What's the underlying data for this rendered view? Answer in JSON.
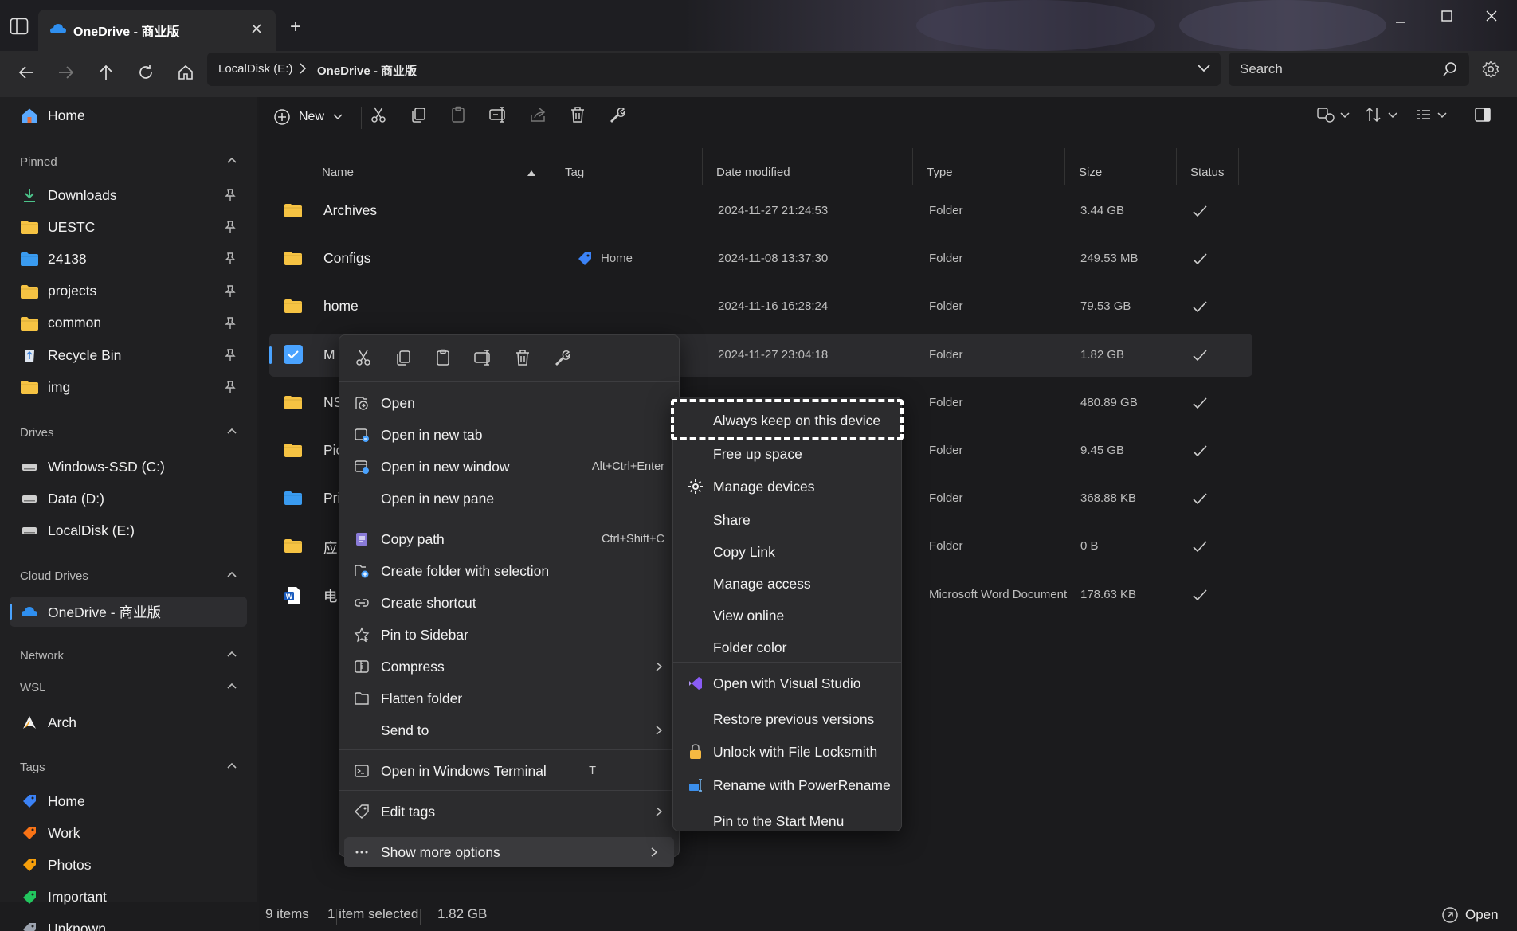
{
  "window": {
    "tab_title": "OneDrive - 商业版",
    "new_tab_glyph": "+",
    "controls": [
      "minimize",
      "maximize",
      "close"
    ]
  },
  "address": {
    "crumbs": [
      "LocalDisk (E:)",
      "OneDrive - 商业版"
    ],
    "search_placeholder": "Search"
  },
  "toolbar": {
    "new_label": "New"
  },
  "sidebar": {
    "home": "Home",
    "pinned_header": "Pinned",
    "pinned": [
      {
        "label": "Downloads",
        "icon": "download-icon"
      },
      {
        "label": "UESTC",
        "icon": "folder-icon"
      },
      {
        "label": "24138",
        "icon": "folder-blue-icon"
      },
      {
        "label": "projects",
        "icon": "folder-icon"
      },
      {
        "label": "common",
        "icon": "folder-icon"
      },
      {
        "label": "Recycle Bin",
        "icon": "recycle-bin-icon"
      },
      {
        "label": "img",
        "icon": "folder-icon"
      }
    ],
    "drives_header": "Drives",
    "drives": [
      "Windows-SSD (C:)",
      "Data (D:)",
      "LocalDisk (E:)"
    ],
    "cloud_header": "Cloud Drives",
    "cloud": [
      "OneDrive - 商业版"
    ],
    "network_header": "Network",
    "wsl_header": "WSL",
    "wsl": [
      "Arch"
    ],
    "tags_header": "Tags",
    "tags": [
      {
        "label": "Home",
        "color": "#3b82f6"
      },
      {
        "label": "Work",
        "color": "#f97316"
      },
      {
        "label": "Photos",
        "color": "#f59e0b"
      },
      {
        "label": "Important",
        "color": "#22c55e"
      },
      {
        "label": "Unknown",
        "color": "#9ca3af"
      }
    ]
  },
  "columns": [
    "Name",
    "Tag",
    "Date modified",
    "Type",
    "Size",
    "Status"
  ],
  "files": [
    {
      "name": "Archives",
      "tag": "",
      "date": "2024-11-27 21:24:53",
      "type": "Folder",
      "size": "3.44 GB",
      "icon": "folder-icon"
    },
    {
      "name": "Configs",
      "tag": "Home",
      "date": "2024-11-08 13:37:30",
      "type": "Folder",
      "size": "249.53 MB",
      "icon": "folder-icon"
    },
    {
      "name": "home",
      "tag": "",
      "date": "2024-11-16 16:28:24",
      "type": "Folder",
      "size": "79.53 GB",
      "icon": "folder-icon"
    },
    {
      "name": "M",
      "tag": "",
      "date": "2024-11-27 23:04:18",
      "type": "Folder",
      "size": "1.82 GB",
      "icon": "folder-icon",
      "selected": true
    },
    {
      "name": "NS",
      "tag": "",
      "date": "",
      "type": "Folder",
      "size": "480.89 GB",
      "icon": "folder-icon"
    },
    {
      "name": "Pic",
      "tag": "",
      "date": "",
      "type": "Folder",
      "size": "9.45 GB",
      "icon": "folder-icon"
    },
    {
      "name": "Pri",
      "tag": "",
      "date": "",
      "type": "Folder",
      "size": "368.88 KB",
      "icon": "folder-blue-icon"
    },
    {
      "name": "应",
      "tag": "",
      "date": "",
      "type": "Folder",
      "size": "0 B",
      "icon": "folder-icon"
    },
    {
      "name": "电",
      "tag": "",
      "date": "",
      "type": "Microsoft Word Document",
      "size": "178.63 KB",
      "icon": "word-icon"
    }
  ],
  "context_menu": {
    "items": [
      {
        "label": "Open",
        "shortcut": ""
      },
      {
        "label": "Open in new tab",
        "shortcut": ""
      },
      {
        "label": "Open in new window",
        "shortcut": "Alt+Ctrl+Enter"
      },
      {
        "label": "Open in new pane",
        "shortcut": ""
      },
      {
        "label": "Copy path",
        "shortcut": "Ctrl+Shift+C"
      },
      {
        "label": "Create folder with selection",
        "shortcut": ""
      },
      {
        "label": "Create shortcut",
        "shortcut": ""
      },
      {
        "label": "Pin to Sidebar",
        "shortcut": ""
      },
      {
        "label": "Compress",
        "shortcut": ""
      },
      {
        "label": "Flatten folder",
        "shortcut": ""
      },
      {
        "label": "Send to",
        "shortcut": ""
      },
      {
        "label": "Open in Windows Terminal",
        "shortcut": "T"
      },
      {
        "label": "Edit tags",
        "shortcut": ""
      },
      {
        "label": "Show more options",
        "shortcut": ""
      }
    ]
  },
  "submenu": {
    "items": [
      "Always keep on this device",
      "Free up space",
      "Manage devices",
      "Share",
      "Copy Link",
      "Manage access",
      "View online",
      "Folder color",
      "Open with Visual Studio",
      "Restore previous versions",
      "Unlock with File Locksmith",
      "Rename with PowerRename",
      "Pin to the Start Menu"
    ]
  },
  "status": {
    "items": "9 items",
    "selected": "1 item selected",
    "size": "1.82 GB",
    "open": "Open"
  }
}
